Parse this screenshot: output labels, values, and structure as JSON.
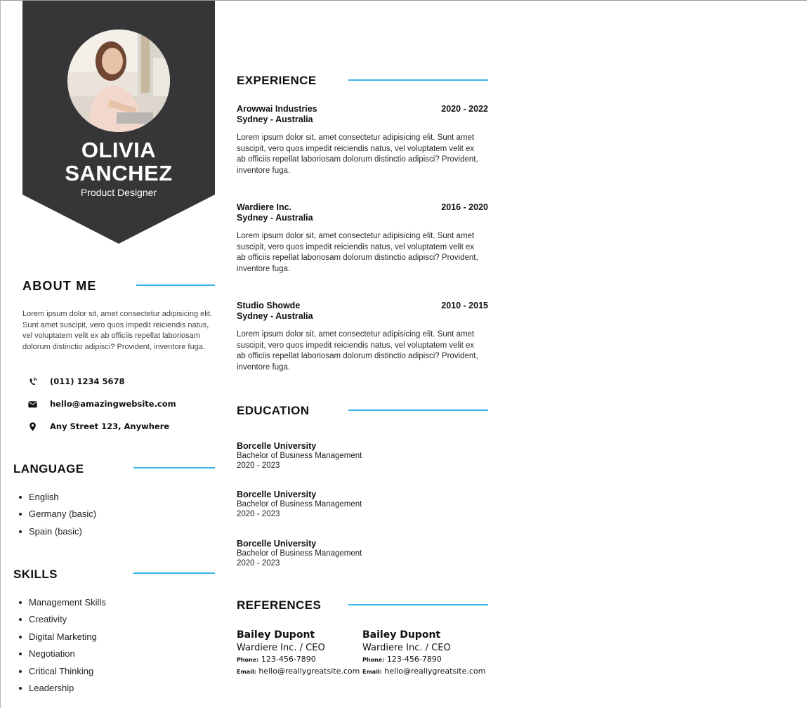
{
  "profile": {
    "first_name": "OLIVIA",
    "last_name": "SANCHEZ",
    "role": "Product Designer"
  },
  "about": {
    "heading": "ABOUT ME",
    "text": "Lorem ipsum dolor sit, amet consectetur adipisicing elit. Sunt amet suscipit, vero quos impedit reiciendis natus, vel voluptatem velit ex ab officiis repellat laboriosam dolorum distinctio adipisci? Provident, inventore fuga."
  },
  "contact": {
    "phone": "(011) 1234 5678",
    "email": "hello@amazingwebsite.com",
    "address": "Any Street 123, Anywhere"
  },
  "language": {
    "heading": "LANGUAGE",
    "items": [
      "English",
      "Germany (basic)",
      "Spain (basic)"
    ]
  },
  "skills": {
    "heading": "SKILLS",
    "items": [
      "Management Skills",
      "Creativity",
      "Digital Marketing",
      "Negotiation",
      "Critical Thinking",
      "Leadership"
    ]
  },
  "experience": {
    "heading": "EXPERIENCE",
    "jobs": [
      {
        "company": "Arowwai Industries",
        "location": "Sydney - Australia",
        "years": "2020 - 2022",
        "text": "Lorem ipsum dolor sit, amet consectetur adipisicing elit. Sunt amet suscipit, vero quos impedit reiciendis natus, vel voluptatem velit ex ab officiis repellat laboriosam dolorum distinctio adipisci? Provident, inventore fuga."
      },
      {
        "company": "Wardiere Inc.",
        "location": "Sydney - Australia",
        "years": "2016 - 2020",
        "text": "Lorem ipsum dolor sit, amet consectetur adipisicing elit. Sunt amet suscipit, vero quos impedit reiciendis natus, vel voluptatem velit ex ab officiis repellat laboriosam dolorum distinctio adipisci? Provident, inventore fuga."
      },
      {
        "company": "Studio Showde",
        "location": "Sydney - Australia",
        "years": "2010 - 2015",
        "text": "Lorem ipsum dolor sit, amet consectetur adipisicing elit. Sunt amet suscipit, vero quos impedit reiciendis natus, vel voluptatem velit ex ab officiis repellat laboriosam dolorum distinctio adipisci? Provident, inventore fuga."
      }
    ]
  },
  "education": {
    "heading": "EDUCATION",
    "items": [
      {
        "school": "Borcelle University",
        "degree": "Bachelor of Business Management",
        "years": "2020 - 2023"
      },
      {
        "school": "Borcelle University",
        "degree": "Bachelor of Business Management",
        "years": "2020 - 2023"
      },
      {
        "school": "Borcelle University",
        "degree": "Bachelor of Business Management",
        "years": "2020 - 2023"
      }
    ]
  },
  "references": {
    "heading": "REFERENCES",
    "phone_label": "Phone:",
    "email_label": "Email:",
    "items": [
      {
        "name": "Bailey Dupont",
        "role": "Wardiere Inc. / CEO",
        "phone": "123-456-7890",
        "email": "hello@reallygreatsite.com"
      },
      {
        "name": "Bailey Dupont",
        "role": "Wardiere Inc. / CEO",
        "phone": "123-456-7890",
        "email": "hello@reallygreatsite.com"
      }
    ]
  },
  "colors": {
    "banner": "#363538",
    "accent_rule": "#3bb3ea"
  }
}
